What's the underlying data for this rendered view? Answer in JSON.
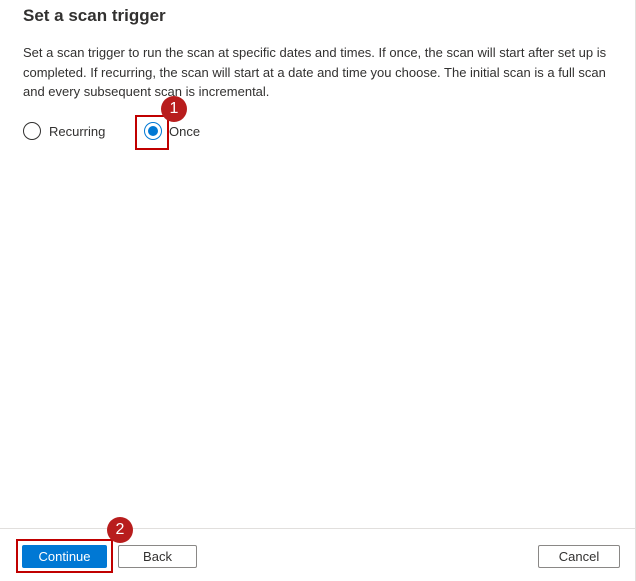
{
  "panel": {
    "title": "Set a scan trigger",
    "description": "Set a scan trigger to run the scan at specific dates and times. If once, the scan will start after set up is completed. If recurring, the scan will start at a date and time you choose. The initial scan is a full scan and every subsequent scan is incremental."
  },
  "trigger_options": [
    {
      "label": "Recurring",
      "selected": false
    },
    {
      "label": "Once",
      "selected": true
    }
  ],
  "annotations": {
    "step_1": "1",
    "step_2": "2",
    "highlight_color": "#c00000",
    "badge_color": "#b81d1d"
  },
  "footer": {
    "continue_label": "Continue",
    "back_label": "Back",
    "cancel_label": "Cancel"
  },
  "colors": {
    "accent": "#0078d4",
    "text": "#323130"
  }
}
